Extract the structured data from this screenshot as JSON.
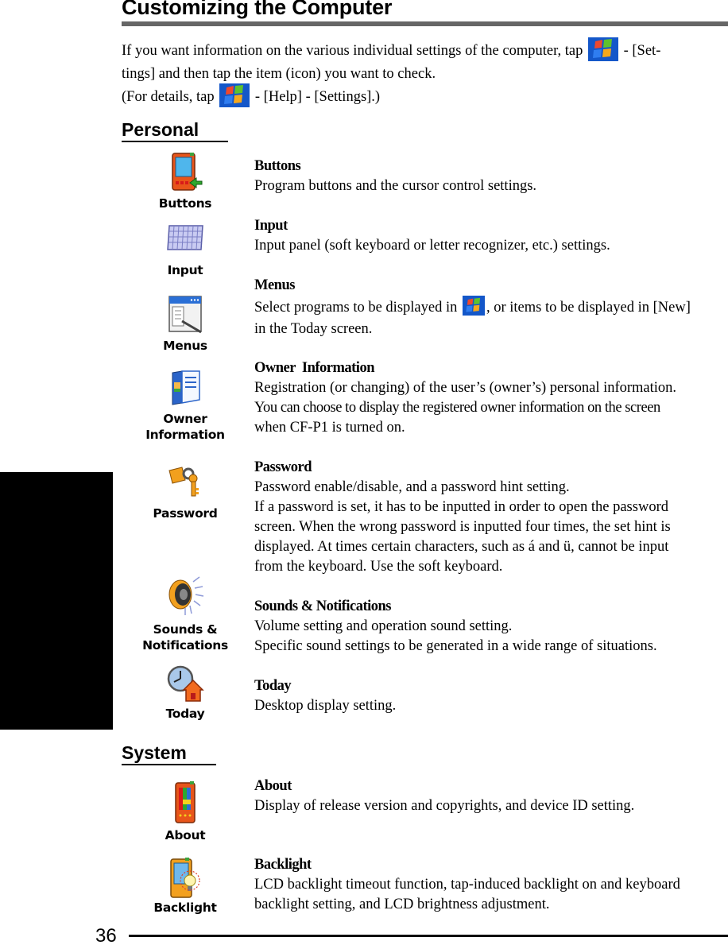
{
  "page": {
    "title": "Customizing the Computer",
    "page_number": "36"
  },
  "intro": {
    "line1_before": "If you want information on the various individual settings of the computer, tap",
    "line1_after": "- [Set-",
    "line2": "tings] and then tap the item (icon) you want to check.",
    "line3_before": "(For details, tap",
    "line3_after": "- [Help] - [Settings].)",
    "start_icon": "windows-start-icon"
  },
  "sections": {
    "personal": {
      "heading": "Personal",
      "items": [
        {
          "icon": "buttons-icon",
          "icon_label": "Buttons",
          "name": "Buttons",
          "lines": [
            "Program buttons and the cursor control settings."
          ]
        },
        {
          "icon": "input-icon",
          "icon_label": "Input",
          "name": "Input",
          "lines": [
            "Input panel (soft keyboard or letter recognizer, etc.) settings."
          ]
        },
        {
          "icon": "menus-icon",
          "icon_label": "Menus",
          "name": "Menus",
          "line1_before": "Select programs to be displayed in",
          "line1_after": ", or items to be displayed in [New]",
          "lines": [
            "in the Today screen."
          ]
        },
        {
          "icon": "owner-information-icon",
          "icon_label_1": "Owner",
          "icon_label_2": "Information",
          "name": "Owner  Information",
          "lines": [
            "Registration (or changing) of the user’s (owner’s) personal information.",
            "You can choose to display the registered owner information on the screen",
            "when CF-P1 is turned on."
          ]
        },
        {
          "icon": "password-icon",
          "icon_label": "Password",
          "name": "Password",
          "lines": [
            "Password enable/disable, and a password hint setting.",
            "If a password is set, it has to be inputted in order to open the password",
            "screen. When the wrong password is inputted four times, the set hint is",
            "displayed. At times certain characters, such as á and ü, cannot be input",
            "from the keyboard. Use the soft keyboard."
          ]
        },
        {
          "icon": "sounds-notifications-icon",
          "icon_label_1": "Sounds &",
          "icon_label_2": "Notifications",
          "name": "Sounds & Notifications",
          "lines": [
            "Volume setting and operation sound setting.",
            "Specific sound settings to be generated in a wide range of situations."
          ]
        },
        {
          "icon": "today-icon",
          "icon_label": "Today",
          "name": "Today",
          "lines": [
            "Desktop display setting."
          ]
        }
      ]
    },
    "system": {
      "heading": "System",
      "items": [
        {
          "icon": "about-icon",
          "icon_label": "About",
          "name": "About",
          "lines": [
            "Display of release version and copyrights, and device ID setting."
          ]
        },
        {
          "icon": "backlight-icon",
          "icon_label": "Backlight",
          "name": "Backlight",
          "lines": [
            "LCD backlight timeout function, tap-induced backlight on and keyboard",
            "backlight setting, and LCD brightness adjustment."
          ]
        }
      ]
    }
  },
  "colors": {
    "title_rule": "#666666",
    "side_tab": "#000000",
    "start_icon_bg": "#1457c9"
  }
}
